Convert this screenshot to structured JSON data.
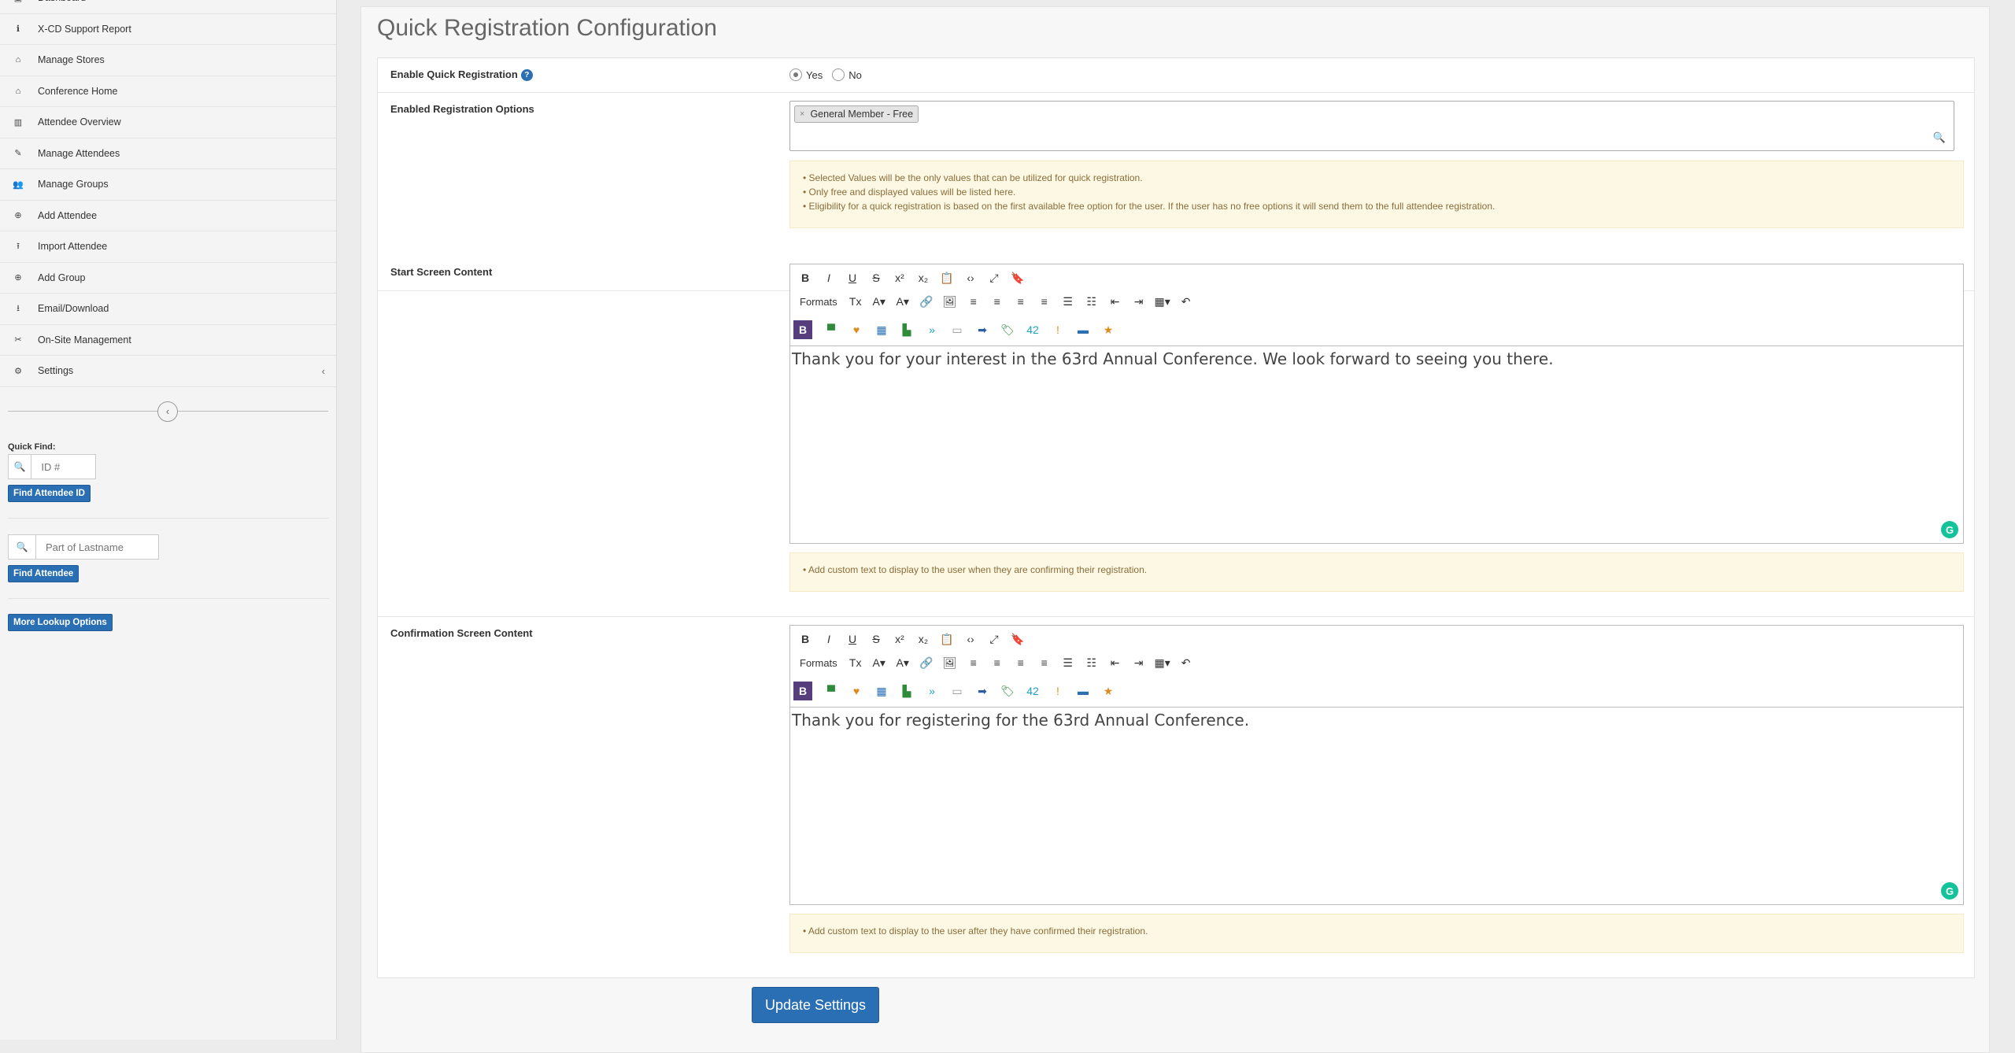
{
  "sidebar": {
    "items": [
      {
        "label": "Dashboard",
        "icon": "dashboard-icon",
        "glyph": "▣"
      },
      {
        "label": "X-CD Support Report",
        "icon": "info-icon",
        "glyph": "ℹ"
      },
      {
        "label": "Manage Stores",
        "icon": "home-icon",
        "glyph": "⌂"
      },
      {
        "label": "Conference Home",
        "icon": "home-icon",
        "glyph": "⌂"
      },
      {
        "label": "Attendee Overview",
        "icon": "bar-chart-icon",
        "glyph": "▥"
      },
      {
        "label": "Manage Attendees",
        "icon": "edit-icon",
        "glyph": "✎"
      },
      {
        "label": "Manage Groups",
        "icon": "users-icon",
        "glyph": "👥"
      },
      {
        "label": "Add Attendee",
        "icon": "plus-circle-icon",
        "glyph": "⊕"
      },
      {
        "label": "Import Attendee",
        "icon": "upload-icon",
        "glyph": "⭱"
      },
      {
        "label": "Add Group",
        "icon": "plus-circle-icon",
        "glyph": "⊕"
      },
      {
        "label": "Email/Download",
        "icon": "download-icon",
        "glyph": "⭳"
      },
      {
        "label": "On-Site Management",
        "icon": "tools-icon",
        "glyph": "✂"
      },
      {
        "label": "Settings",
        "icon": "gears-icon",
        "glyph": "⚙"
      }
    ],
    "settings_chevron": "‹",
    "collapse_glyph": "‹",
    "quick_find": {
      "label": "Quick Find:",
      "id_placeholder": "ID #",
      "find_id_button": "Find Attendee ID",
      "lastname_placeholder": "Part of Lastname",
      "find_attendee_button": "Find Attendee",
      "more_lookup_button": "More Lookup Options",
      "search_glyph": "🔍"
    }
  },
  "page": {
    "title": "Quick Registration Configuration"
  },
  "form": {
    "enable_quick_registration": {
      "label": "Enable Quick Registration",
      "help_glyph": "?",
      "options": [
        "Yes",
        "No"
      ],
      "selected": "Yes"
    },
    "enabled_options": {
      "label": "Enabled Registration Options",
      "selected_tag": "General Member - Free",
      "tag_remove_glyph": "×",
      "search_glyph": "🔍",
      "notes": [
        "• Selected Values will be the only values that can be utilized for quick registration.",
        "• Only free and displayed values will be listed here.",
        "• Eligibility for a quick registration is based on the first available free option for the user. If the user has no free options it will send them to the full attendee registration."
      ]
    },
    "start_screen": {
      "label": "Start Screen Content",
      "content": "Thank you for your interest in the  63rd Annual Conference. We look forward to seeing you there.",
      "note": "• Add custom text to display to the user when they are confirming their registration."
    },
    "confirmation_screen": {
      "label": "Confirmation Screen Content",
      "content": "Thank you for registering for the 63rd Annual Conference.",
      "note": "• Add custom text to display to the user after they have confirmed their registration."
    },
    "editor_toolbar": {
      "formats_label": "Formats",
      "row1": [
        {
          "name": "bold-icon",
          "glyph": "B"
        },
        {
          "name": "italic-icon",
          "glyph": "I"
        },
        {
          "name": "underline-icon",
          "glyph": "U"
        },
        {
          "name": "strikethrough-icon",
          "glyph": "S"
        },
        {
          "name": "superscript-icon",
          "glyph": "x²"
        },
        {
          "name": "subscript-icon",
          "glyph": "x₂"
        },
        {
          "name": "paste-icon",
          "glyph": "📋"
        },
        {
          "name": "code-icon",
          "glyph": "‹›"
        },
        {
          "name": "fullscreen-icon",
          "glyph": "⤢"
        },
        {
          "name": "bookmark-icon",
          "glyph": "🔖"
        }
      ],
      "row2": [
        {
          "name": "clear-format-icon",
          "glyph": "Tx"
        },
        {
          "name": "text-color-icon",
          "glyph": "A▾"
        },
        {
          "name": "background-color-icon",
          "glyph": "A▾"
        },
        {
          "name": "link-icon",
          "glyph": "🔗"
        },
        {
          "name": "image-icon",
          "glyph": "🖼"
        },
        {
          "name": "align-left-icon",
          "glyph": "≡"
        },
        {
          "name": "align-center-icon",
          "glyph": "≡"
        },
        {
          "name": "align-right-icon",
          "glyph": "≡"
        },
        {
          "name": "align-justify-icon",
          "glyph": "≡"
        },
        {
          "name": "bullet-list-icon",
          "glyph": "☰"
        },
        {
          "name": "numbered-list-icon",
          "glyph": "☷"
        },
        {
          "name": "outdent-icon",
          "glyph": "⇤"
        },
        {
          "name": "indent-icon",
          "glyph": "⇥"
        },
        {
          "name": "table-icon",
          "glyph": "▦▾"
        },
        {
          "name": "undo-icon",
          "glyph": "↶"
        }
      ],
      "row3": [
        {
          "name": "bootstrap-icon",
          "glyph": "B",
          "color": "#563d7c"
        },
        {
          "name": "template-icon",
          "glyph": "▀",
          "color": "#2e8b3a"
        },
        {
          "name": "heart-icon",
          "glyph": "♥",
          "color": "#e08a1e"
        },
        {
          "name": "table-grid-icon",
          "glyph": "▦",
          "color": "#2a6fb3"
        },
        {
          "name": "layout-icon",
          "glyph": "▙",
          "color": "#2e8b3a"
        },
        {
          "name": "forward-icon",
          "glyph": "»",
          "color": "#1aa3c4"
        },
        {
          "name": "snippet-icon",
          "glyph": "▭",
          "color": "#999999"
        },
        {
          "name": "arrow-button-icon",
          "glyph": "➡",
          "color": "#2a5fa8"
        },
        {
          "name": "tag-icon",
          "glyph": "🏷",
          "color": "#2e8b3a"
        },
        {
          "name": "badge-icon",
          "glyph": "42",
          "color": "#1aa3c4"
        },
        {
          "name": "alert-icon",
          "glyph": "!",
          "color": "#e08a1e"
        },
        {
          "name": "panel-icon",
          "glyph": "▬",
          "color": "#2a6fb3"
        },
        {
          "name": "star-icon",
          "glyph": "★",
          "color": "#e08a1e"
        }
      ]
    },
    "grammarly_glyph": "G",
    "submit_label": "Update Settings"
  },
  "colors": {
    "primary": "#2a6fb3",
    "note_bg": "#fcf8e3",
    "note_text": "#8a6d3b"
  }
}
